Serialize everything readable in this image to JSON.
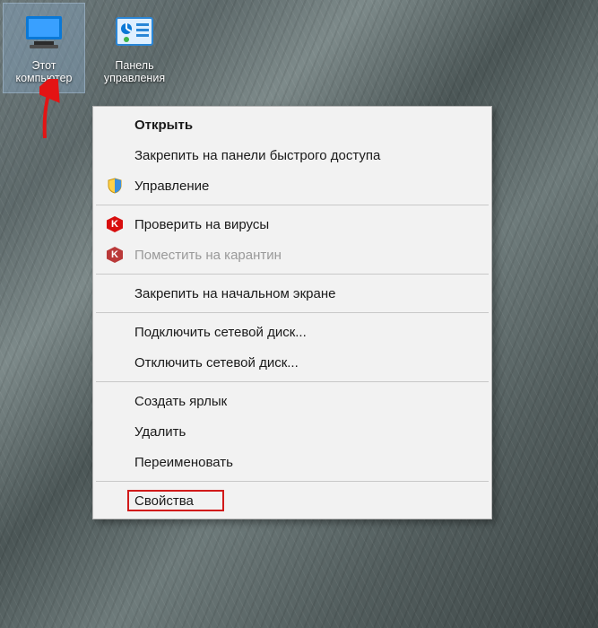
{
  "desktop": {
    "icons": [
      {
        "id": "this-pc",
        "label": "Этот компьютер",
        "selected": true
      },
      {
        "id": "control-panel",
        "label": "Панель управления",
        "selected": false
      }
    ]
  },
  "context_menu": {
    "groups": [
      [
        {
          "id": "open",
          "label": "Открыть",
          "bold": true
        },
        {
          "id": "pin-quick",
          "label": "Закрепить на панели быстрого доступа"
        },
        {
          "id": "manage",
          "label": "Управление",
          "icon": "shield"
        }
      ],
      [
        {
          "id": "av-scan",
          "label": "Проверить на вирусы",
          "icon": "kaspersky"
        },
        {
          "id": "av-quar",
          "label": "Поместить на карантин",
          "icon": "kaspersky",
          "disabled": true
        }
      ],
      [
        {
          "id": "pin-start",
          "label": "Закрепить на начальном экране"
        }
      ],
      [
        {
          "id": "map-drive",
          "label": "Подключить сетевой диск..."
        },
        {
          "id": "unmap-drive",
          "label": "Отключить сетевой диск..."
        }
      ],
      [
        {
          "id": "shortcut",
          "label": "Создать ярлык"
        },
        {
          "id": "delete",
          "label": "Удалить"
        },
        {
          "id": "rename",
          "label": "Переименовать"
        }
      ],
      [
        {
          "id": "properties",
          "label": "Свойства",
          "highlight": true
        }
      ]
    ]
  }
}
